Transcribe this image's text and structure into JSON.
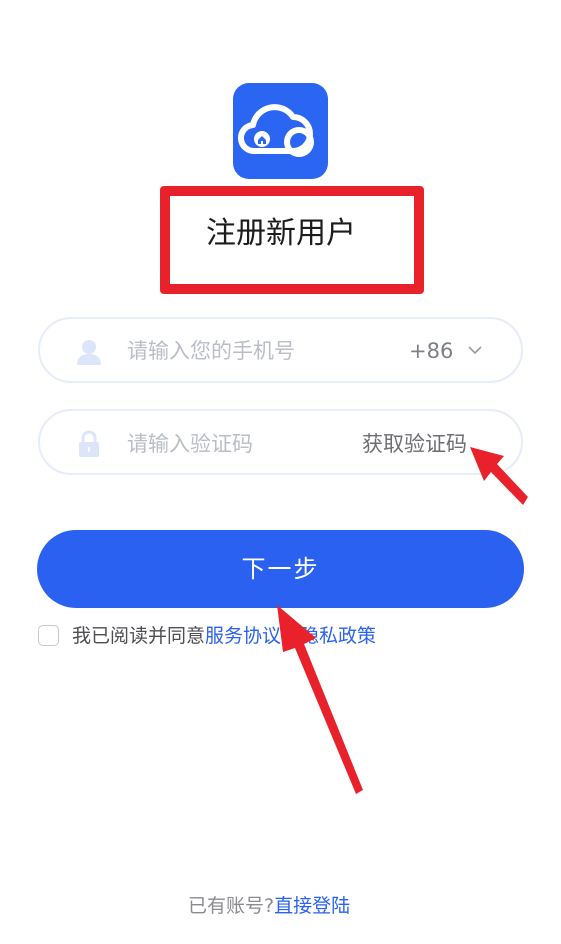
{
  "register": {
    "title": "注册新用户"
  },
  "phone": {
    "placeholder": "请输入您的手机号",
    "country_code": "+86"
  },
  "code": {
    "placeholder": "请输入验证码",
    "get_code_label": "获取验证码"
  },
  "next_label": "下一步",
  "agreement": {
    "prefix": "我已阅读并同意",
    "service_link": "服务协议",
    "and": "和",
    "privacy_link": "隐私政策"
  },
  "footer": {
    "prompt": "已有账号?",
    "login_link": "直接登陆"
  },
  "colors": {
    "brand_blue": "#2a61f0",
    "annotation_red": "#e8212a"
  },
  "icons": {
    "logo": "cloud-home-icon",
    "phone_field": "user-icon",
    "code_field": "lock-icon",
    "dropdown": "chevron-down-icon"
  }
}
